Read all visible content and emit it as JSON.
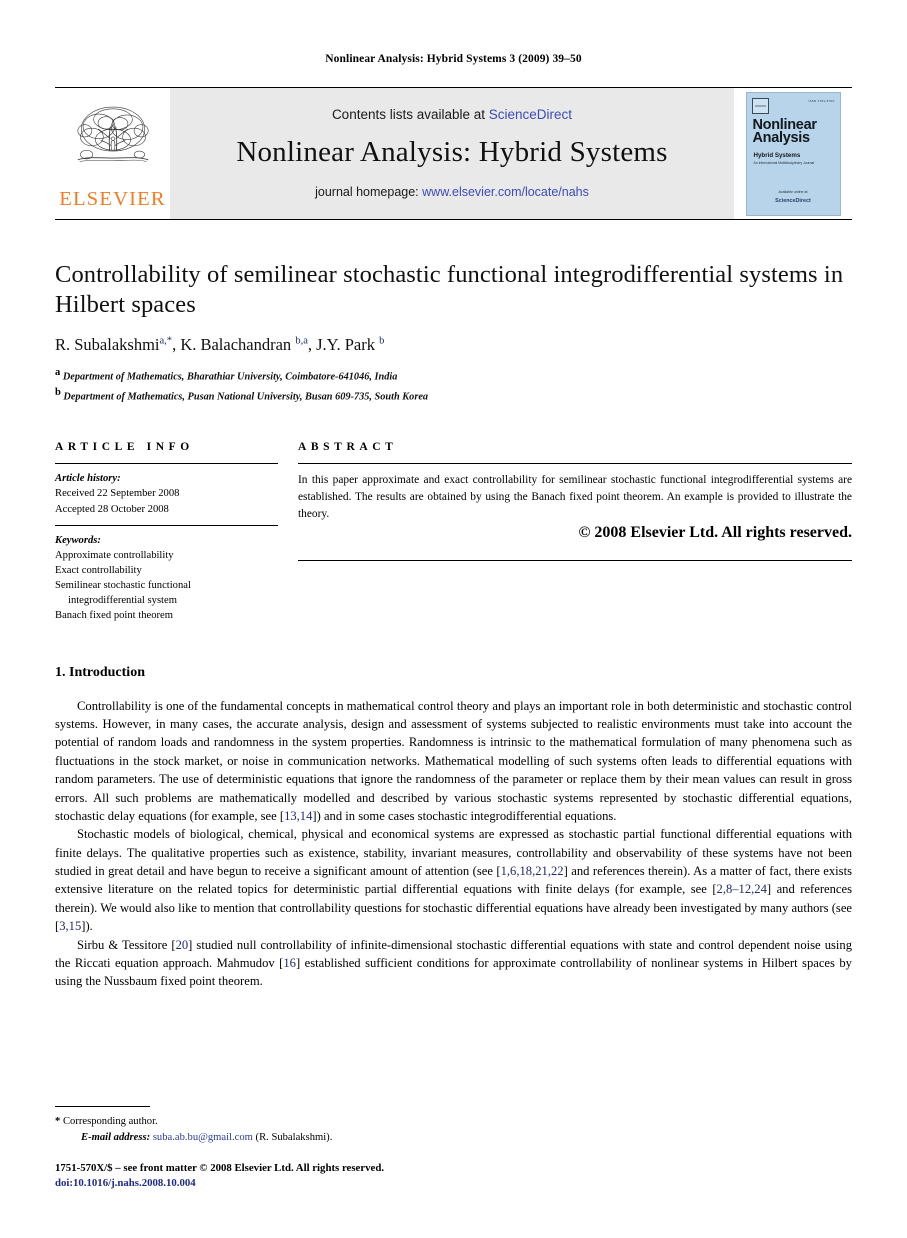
{
  "running_head": "Nonlinear Analysis: Hybrid Systems 3 (2009) 39–50",
  "masthead": {
    "logo_word": "ELSEVIER",
    "logo_icon": "elsevier-tree-logo",
    "contents_prefix": "Contents lists available at ",
    "contents_link": "ScienceDirect",
    "journal_name": "Nonlinear Analysis: Hybrid Systems",
    "homepage_prefix": "journal homepage: ",
    "homepage_url": "www.elsevier.com/locate/nahs",
    "cover": {
      "issn": "ISSN 1751-570X",
      "title_line1": "Nonlinear",
      "title_line2": "Analysis",
      "subtitle": "Hybrid Systems",
      "subtitle2": "An International Multidisciplinary Journal",
      "bottom_text": "Available online at",
      "bottom_brand": "ScienceDirect"
    }
  },
  "article": {
    "title": "Controllability of semilinear stochastic functional integrodifferential systems in Hilbert spaces",
    "authors": [
      {
        "name": "R. Subalakshmi",
        "sup": "a,*"
      },
      {
        "name": "K. Balachandran",
        "sup": "b,a"
      },
      {
        "name": "J.Y. Park",
        "sup": "b"
      }
    ],
    "authors_plain": "R. Subalakshmi a,*, K. Balachandran b,a, J.Y. Park b",
    "affiliations": [
      {
        "mark": "a",
        "text": "Department of Mathematics, Bharathiar University, Coimbatore-641046, India"
      },
      {
        "mark": "b",
        "text": "Department of Mathematics, Pusan National University, Busan 609-735, South Korea"
      }
    ]
  },
  "info": {
    "heading": "ARTICLE INFO",
    "history_label": "Article history:",
    "history": [
      "Received 22 September 2008",
      "Accepted 28 October 2008"
    ],
    "keywords_label": "Keywords:",
    "keywords": [
      "Approximate controllability",
      "Exact controllability",
      "Semilinear stochastic functional",
      "integrodifferential system",
      "Banach fixed point theorem"
    ]
  },
  "abstract": {
    "heading": "ABSTRACT",
    "text": "In this paper approximate and exact controllability for semilinear stochastic functional integrodifferential systems are established. The results are obtained by using the Banach fixed point theorem. An example is provided to illustrate the theory.",
    "copyright": "© 2008 Elsevier Ltd. All rights reserved."
  },
  "body": {
    "section_title": "1. Introduction",
    "paragraph1_a": "Controllability is one of the fundamental concepts in mathematical control theory and plays an important role in both deterministic and stochastic control systems. However, in many cases, the accurate analysis, design and assessment of systems subjected to realistic environments must take into account the potential of random loads and randomness in the system properties. Randomness is intrinsic to the mathematical formulation of many phenomena such as fluctuations in the stock market, or noise in communication networks. Mathematical modelling of such systems often leads to differential equations with random parameters. The use of deterministic equations that ignore the randomness of the parameter or replace them by their mean values can result in gross errors. All such problems are mathematically modelled and described by various stochastic systems represented by stochastic differential equations, stochastic delay equations (for example, see [",
    "p1_cite1": "13,14",
    "paragraph1_b": "]) and in some cases stochastic integrodifferential equations.",
    "paragraph2_a": "Stochastic models of biological, chemical, physical and economical systems are expressed as stochastic partial functional differential equations with finite delays. The qualitative properties such as existence, stability, invariant measures, controllability and observability of these systems have not been studied in great detail and have begun to receive a significant amount of attention (see [",
    "p2_cite1": "1,6,18,21,22",
    "paragraph2_b": "] and references therein). As a matter of fact, there exists extensive literature on the related topics for deterministic partial differential equations with finite delays (for example, see [",
    "p2_cite2": "2,8–12,24",
    "paragraph2_c": "] and references therein). We would also like to mention that controllability questions for stochastic differential equations have already been investigated by many authors (see [",
    "p2_cite3": "3,15",
    "paragraph2_d": "]).",
    "paragraph3_a": "Sirbu & Tessitore [",
    "p3_cite1": "20",
    "paragraph3_b": "] studied null controllability of infinite-dimensional stochastic differential equations with state and control dependent noise using the Riccati equation approach. Mahmudov [",
    "p3_cite2": "16",
    "paragraph3_c": "] established sufficient conditions for approximate controllability of nonlinear systems in Hilbert spaces by using the  Nussbaum fixed point theorem."
  },
  "footnote": {
    "star": "*",
    "corresponding": "Corresponding author.",
    "email_label": "E-mail address:",
    "email": "suba.ab.bu@gmail.com",
    "email_owner": "(R. Subalakshmi).",
    "imprint": "1751-570X/$ – see front matter © 2008 Elsevier Ltd. All rights reserved.",
    "doi": "doi:10.1016/j.nahs.2008.10.004"
  },
  "colors": {
    "link_blue": "#3b4cb8",
    "cite_navy": "#1f2a6e",
    "elsevier_orange": "#F47B20",
    "masthead_gray": "#e9e9e9",
    "cover_blue": "#b8d4ea"
  }
}
